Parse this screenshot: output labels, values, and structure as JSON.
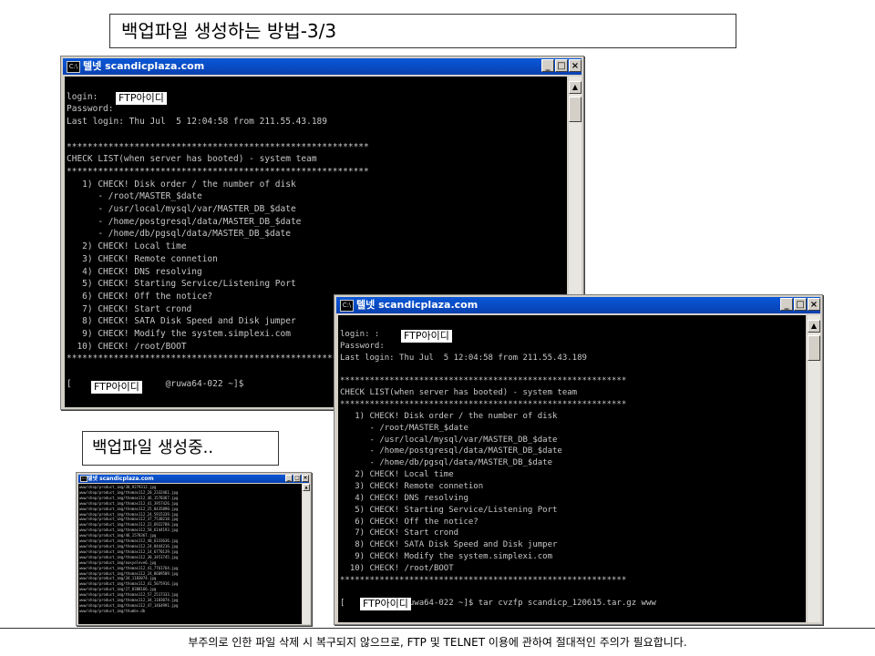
{
  "title": "백업파일 생성하는 방법-3/3",
  "section_label": "백업파일 생성중..",
  "notice": "부주의로 인한 파일 삭제 시 복구되지 않으므로, FTP 및 TELNET 이용에 관하여 절대적인 주의가 필요합니다.",
  "window1": {
    "title": "텔넷 scandicplaza.com",
    "console": "\nlogin:\nPassword:\nLast login: Thu Jul  5 12:04:58 from 211.55.43.189\n\n**********************************************************\nCHECK LIST(when server has booted) - system team\n**********************************************************\n   1) CHECK! Disk order / the number of disk\n      - /root/MASTER_$date\n      - /usr/local/mysql/var/MASTER_DB_$date\n      - /home/postgresql/data/MASTER_DB_$date\n      - /home/db/pgsql/data/MASTER_DB_$date\n   2) CHECK! Local time\n   3) CHECK! Remote connetion\n   4) CHECK! DNS resolving\n   5) CHECK! Starting Service/Listening Port\n   6) CHECK! Off the notice?\n   7) CHECK! Start crond\n   8) CHECK! SATA Disk Speed and Disk jumper\n   9) CHECK! Modify the system.simplexi.com\n  10) CHECK! /root/BOOT\n**********************************************************\n\n[                  @ruwa64-022 ~]$",
    "login_mask": "FTP아이디",
    "prompt_mask": "FTP아이디"
  },
  "window2": {
    "title": "텔넷 scandicplaza.com",
    "console": "login: :\nPassword:\nLast login: Thu Jul  5 12:04:58 from 211.55.43.189\n\n**********************************************************\nCHECK LIST(when server has booted) - system team\n**********************************************************\n   1) CHECK! Disk order / the number of disk\n      - /root/MASTER_$date\n      - /usr/local/mysql/var/MASTER_DB_$date\n      - /home/postgresql/data/MASTER_DB_$date\n      - /home/db/pgsql/data/MASTER_DB_$date\n   2) CHECK! Local time\n   3) CHECK! Remote connetion\n   4) CHECK! DNS resolving\n   5) CHECK! Starting Service/Listening Port\n   6) CHECK! Off the notice?\n   7) CHECK! Start crond\n   8) CHECK! SATA Disk Speed and Disk jumper\n   9) CHECK! Modify the system.simplexi.com\n  10) CHECK! /root/BOOT\n**********************************************************\n\n[            ruwa64-022 ~]$ tar cvzfp scandicp_120615.tar.gz www",
    "login_mask": "FTP아이디",
    "prompt_mask": "FTP아이디"
  },
  "window3": {
    "title": "텔넷 scandicplaza.com",
    "lines": [
      "www/shop/product_img/30_9279312.jpg",
      "www/shop/product_img/thomas112_20_2332461.jpg",
      "www/shop/product_img/thomas112_46_1578367.jpg",
      "www/shop/product_img/thomas112_41_3957426.jpg",
      "www/shop/product_img/thomas112_25_8435890.jpg",
      "www/shop/product_img/thomas112_24_5915339.jpg",
      "www/shop/product_img/thomas112_37_7538218.jpg",
      "www/shop/product_img/thomas112_22_6922788.jpg",
      "www/shop/product_img/thomas112_58_6144193.jpg",
      "www/shop/product_img/46_1578367.jpg",
      "www/shop/product_img/thomas112_40_6333636.jpg",
      "www/shop/product_img/thomas112_24_8444216.jpg",
      "www/shop/product_img/thomas112_14_6770139.jpg",
      "www/shop/product_img/thomas112_30_3451745.jpg",
      "www/shop/product_img/easyeleve6.jpg",
      "www/shop/product_img/thomas112_41_7761764.jpg",
      "www/shop/product_img/thomas112_24_8689509.jpg",
      "www/shop/product_img/34_1183074.jpg",
      "www/shop/product_img/thomas112_41_5075916.jpg",
      "www/shop/product_img/27_8388166.jpg",
      "www/shop/product_img/thomas112_57_2517333.jpg",
      "www/shop/product_img/thomas112_34_1183074.jpg",
      "www/shop/product_img/thomas112_47_1464991.jpg",
      "www/shop/product_img/thumbs.db"
    ]
  },
  "titlebar_icon": "C:\\",
  "buttons": {
    "minimize": "_",
    "maximize": "□",
    "close": "×"
  }
}
